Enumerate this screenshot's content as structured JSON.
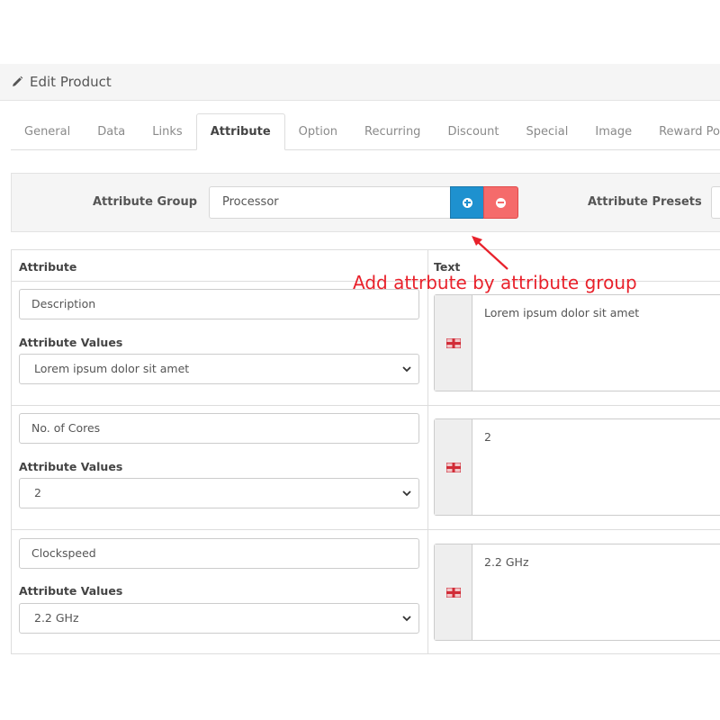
{
  "header": {
    "title": "Edit Product",
    "icon": "pencil-icon"
  },
  "tabs": [
    {
      "label": "General",
      "active": false
    },
    {
      "label": "Data",
      "active": false
    },
    {
      "label": "Links",
      "active": false
    },
    {
      "label": "Attribute",
      "active": true
    },
    {
      "label": "Option",
      "active": false
    },
    {
      "label": "Recurring",
      "active": false
    },
    {
      "label": "Discount",
      "active": false
    },
    {
      "label": "Special",
      "active": false
    },
    {
      "label": "Image",
      "active": false
    },
    {
      "label": "Reward Points",
      "active": false
    }
  ],
  "group_bar": {
    "group_label": "Attribute Group",
    "group_value": "Processor",
    "add_icon": "plus-circle-icon",
    "remove_icon": "minus-circle-icon",
    "preset_label": "Attribute Presets"
  },
  "table": {
    "col_attribute": "Attribute",
    "col_text": "Text",
    "values_label": "Attribute Values",
    "rows": [
      {
        "name": "Description",
        "selected_value": "Lorem ipsum dolor sit amet",
        "text": "Lorem ipsum dolor sit amet"
      },
      {
        "name": "No. of Cores",
        "selected_value": "2",
        "text": "2"
      },
      {
        "name": "Clockspeed",
        "selected_value": "2.2 GHz",
        "text": "2.2 GHz"
      }
    ]
  },
  "annotation": {
    "text": "Add attrbute by attribute group",
    "color": "#e8212b"
  },
  "colors": {
    "primary": "#1e91cf",
    "danger": "#f56b6b",
    "heading_bg": "#f5f5f5"
  }
}
